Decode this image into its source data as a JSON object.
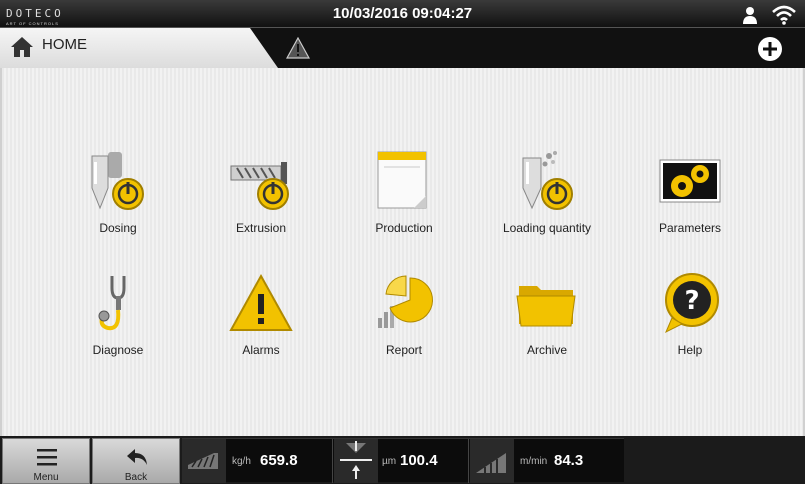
{
  "topbar": {
    "logo_name": "DOTECO",
    "logo_tagline": "ART OF CONTROLS",
    "datetime": "10/03/2016 09:04:27"
  },
  "header": {
    "title": "HOME"
  },
  "tiles": [
    {
      "label": "Dosing",
      "icon": "dosing-icon"
    },
    {
      "label": "Extrusion",
      "icon": "extrusion-icon"
    },
    {
      "label": "Production",
      "icon": "production-icon"
    },
    {
      "label": "Loading quantity",
      "icon": "loading-quantity-icon"
    },
    {
      "label": "Parameters",
      "icon": "parameters-icon"
    },
    {
      "label": "Diagnose",
      "icon": "stethoscope-icon"
    },
    {
      "label": "Alarms",
      "icon": "warning-icon"
    },
    {
      "label": "Report",
      "icon": "pie-chart-icon"
    },
    {
      "label": "Archive",
      "icon": "folder-icon"
    },
    {
      "label": "Help",
      "icon": "help-icon"
    }
  ],
  "bottom": {
    "menu_label": "Menu",
    "back_label": "Back",
    "readouts": [
      {
        "unit": "kg/h",
        "value": "659.8"
      },
      {
        "unit": "µm",
        "value": "100.4"
      },
      {
        "unit": "m/min",
        "value": "84.3"
      }
    ]
  },
  "colors": {
    "accent": "#f2c200",
    "dark": "#111111"
  }
}
